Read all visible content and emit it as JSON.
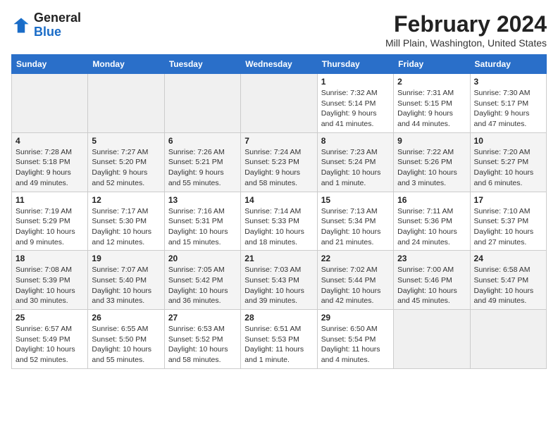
{
  "header": {
    "logo_line1": "General",
    "logo_line2": "Blue",
    "month": "February 2024",
    "location": "Mill Plain, Washington, United States"
  },
  "days_of_week": [
    "Sunday",
    "Monday",
    "Tuesday",
    "Wednesday",
    "Thursday",
    "Friday",
    "Saturday"
  ],
  "weeks": [
    [
      {
        "day": "",
        "info": ""
      },
      {
        "day": "",
        "info": ""
      },
      {
        "day": "",
        "info": ""
      },
      {
        "day": "",
        "info": ""
      },
      {
        "day": "1",
        "info": "Sunrise: 7:32 AM\nSunset: 5:14 PM\nDaylight: 9 hours\nand 41 minutes."
      },
      {
        "day": "2",
        "info": "Sunrise: 7:31 AM\nSunset: 5:15 PM\nDaylight: 9 hours\nand 44 minutes."
      },
      {
        "day": "3",
        "info": "Sunrise: 7:30 AM\nSunset: 5:17 PM\nDaylight: 9 hours\nand 47 minutes."
      }
    ],
    [
      {
        "day": "4",
        "info": "Sunrise: 7:28 AM\nSunset: 5:18 PM\nDaylight: 9 hours\nand 49 minutes."
      },
      {
        "day": "5",
        "info": "Sunrise: 7:27 AM\nSunset: 5:20 PM\nDaylight: 9 hours\nand 52 minutes."
      },
      {
        "day": "6",
        "info": "Sunrise: 7:26 AM\nSunset: 5:21 PM\nDaylight: 9 hours\nand 55 minutes."
      },
      {
        "day": "7",
        "info": "Sunrise: 7:24 AM\nSunset: 5:23 PM\nDaylight: 9 hours\nand 58 minutes."
      },
      {
        "day": "8",
        "info": "Sunrise: 7:23 AM\nSunset: 5:24 PM\nDaylight: 10 hours\nand 1 minute."
      },
      {
        "day": "9",
        "info": "Sunrise: 7:22 AM\nSunset: 5:26 PM\nDaylight: 10 hours\nand 3 minutes."
      },
      {
        "day": "10",
        "info": "Sunrise: 7:20 AM\nSunset: 5:27 PM\nDaylight: 10 hours\nand 6 minutes."
      }
    ],
    [
      {
        "day": "11",
        "info": "Sunrise: 7:19 AM\nSunset: 5:29 PM\nDaylight: 10 hours\nand 9 minutes."
      },
      {
        "day": "12",
        "info": "Sunrise: 7:17 AM\nSunset: 5:30 PM\nDaylight: 10 hours\nand 12 minutes."
      },
      {
        "day": "13",
        "info": "Sunrise: 7:16 AM\nSunset: 5:31 PM\nDaylight: 10 hours\nand 15 minutes."
      },
      {
        "day": "14",
        "info": "Sunrise: 7:14 AM\nSunset: 5:33 PM\nDaylight: 10 hours\nand 18 minutes."
      },
      {
        "day": "15",
        "info": "Sunrise: 7:13 AM\nSunset: 5:34 PM\nDaylight: 10 hours\nand 21 minutes."
      },
      {
        "day": "16",
        "info": "Sunrise: 7:11 AM\nSunset: 5:36 PM\nDaylight: 10 hours\nand 24 minutes."
      },
      {
        "day": "17",
        "info": "Sunrise: 7:10 AM\nSunset: 5:37 PM\nDaylight: 10 hours\nand 27 minutes."
      }
    ],
    [
      {
        "day": "18",
        "info": "Sunrise: 7:08 AM\nSunset: 5:39 PM\nDaylight: 10 hours\nand 30 minutes."
      },
      {
        "day": "19",
        "info": "Sunrise: 7:07 AM\nSunset: 5:40 PM\nDaylight: 10 hours\nand 33 minutes."
      },
      {
        "day": "20",
        "info": "Sunrise: 7:05 AM\nSunset: 5:42 PM\nDaylight: 10 hours\nand 36 minutes."
      },
      {
        "day": "21",
        "info": "Sunrise: 7:03 AM\nSunset: 5:43 PM\nDaylight: 10 hours\nand 39 minutes."
      },
      {
        "day": "22",
        "info": "Sunrise: 7:02 AM\nSunset: 5:44 PM\nDaylight: 10 hours\nand 42 minutes."
      },
      {
        "day": "23",
        "info": "Sunrise: 7:00 AM\nSunset: 5:46 PM\nDaylight: 10 hours\nand 45 minutes."
      },
      {
        "day": "24",
        "info": "Sunrise: 6:58 AM\nSunset: 5:47 PM\nDaylight: 10 hours\nand 49 minutes."
      }
    ],
    [
      {
        "day": "25",
        "info": "Sunrise: 6:57 AM\nSunset: 5:49 PM\nDaylight: 10 hours\nand 52 minutes."
      },
      {
        "day": "26",
        "info": "Sunrise: 6:55 AM\nSunset: 5:50 PM\nDaylight: 10 hours\nand 55 minutes."
      },
      {
        "day": "27",
        "info": "Sunrise: 6:53 AM\nSunset: 5:52 PM\nDaylight: 10 hours\nand 58 minutes."
      },
      {
        "day": "28",
        "info": "Sunrise: 6:51 AM\nSunset: 5:53 PM\nDaylight: 11 hours\nand 1 minute."
      },
      {
        "day": "29",
        "info": "Sunrise: 6:50 AM\nSunset: 5:54 PM\nDaylight: 11 hours\nand 4 minutes."
      },
      {
        "day": "",
        "info": ""
      },
      {
        "day": "",
        "info": ""
      }
    ]
  ]
}
